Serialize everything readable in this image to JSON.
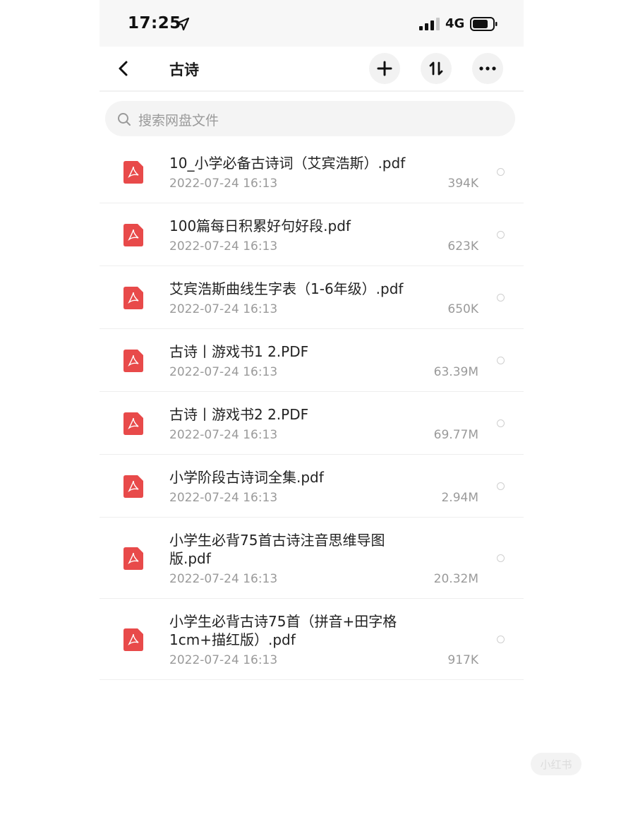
{
  "status_bar": {
    "time": "17:25",
    "network": "4G",
    "icons": [
      "location-arrow-icon",
      "signal-bars-icon",
      "battery-icon"
    ]
  },
  "nav": {
    "back_icon": "chevron-left-icon",
    "title": "古诗",
    "actions": [
      "plus-icon",
      "sort-arrows-icon",
      "more-dots-icon"
    ]
  },
  "search": {
    "placeholder": "搜索网盘文件",
    "icon": "search-icon"
  },
  "files": [
    {
      "name": "10_小学必备古诗词（艾宾浩斯）.pdf",
      "date": "2022-07-24 16:13",
      "size": "394K"
    },
    {
      "name": "100篇每日积累好句好段.pdf",
      "date": "2022-07-24 16:13",
      "size": "623K"
    },
    {
      "name": "艾宾浩斯曲线生字表（1-6年级）.pdf",
      "date": "2022-07-24 16:13",
      "size": "650K"
    },
    {
      "name": "古诗丨游戏书1 2.PDF",
      "date": "2022-07-24 16:13",
      "size": "63.39M"
    },
    {
      "name": "古诗丨游戏书2 2.PDF",
      "date": "2022-07-24 16:13",
      "size": "69.77M"
    },
    {
      "name": "小学阶段古诗词全集.pdf",
      "date": "2022-07-24 16:13",
      "size": "2.94M"
    },
    {
      "name": "小学生必背75首古诗注音思维导图版.pdf",
      "date": "2022-07-24 16:13",
      "size": "20.32M"
    },
    {
      "name": "小学生必背古诗75首（拼音+田字格1cm+描红版）.pdf",
      "date": "2022-07-24 16:13",
      "size": "917K"
    }
  ],
  "colors": {
    "pdf_icon": "#e84a4a",
    "text_primary": "#222222",
    "text_secondary": "#9a9a9a"
  },
  "watermark": "小红书"
}
